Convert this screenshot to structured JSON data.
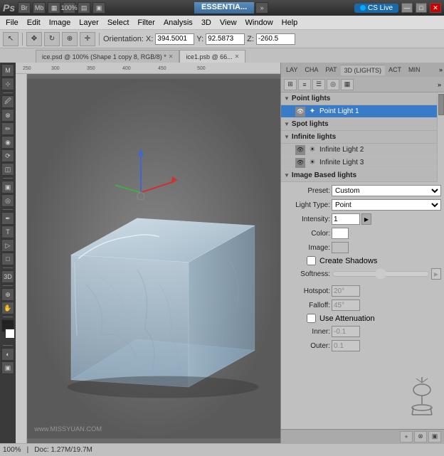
{
  "titlebar": {
    "logo": "Ps",
    "workspace": "ESSENTIA...",
    "cslive": "CS Live",
    "minimize": "—",
    "maximize": "□",
    "close": "✕"
  },
  "menubar": {
    "items": [
      "File",
      "Edit",
      "Image",
      "Layer",
      "Select",
      "Filter",
      "Analysis",
      "3D",
      "View",
      "Window",
      "Help"
    ]
  },
  "toolbar": {
    "zoom": "100%",
    "orientation_label": "Orientation:",
    "x_label": "X:",
    "x_value": "394.5001",
    "y_label": "Y:",
    "y_value": "92.5873",
    "z_label": "Z:",
    "z_value": "-260.5"
  },
  "tabs": [
    {
      "label": "ice.psd @ 100% (Shape 1 copy 8, RGB/8) *",
      "active": true
    },
    {
      "label": "ice1.psb @ 66...",
      "active": false
    }
  ],
  "panel": {
    "tabs": [
      "LAY",
      "CHA",
      "PAT",
      "3D (LIGHTS)",
      "ACT",
      "MIN"
    ],
    "active_tab": "3D (LIGHTS)",
    "icons": [
      "⊞",
      "≡",
      "☰",
      "⊙",
      "▦"
    ]
  },
  "lights": {
    "groups": [
      {
        "name": "Point lights",
        "items": [
          {
            "name": "Point Light 1",
            "selected": true,
            "visible": true
          }
        ]
      },
      {
        "name": "Spot lights",
        "items": []
      },
      {
        "name": "Infinite lights",
        "items": [
          {
            "name": "Infinite Light 2",
            "visible": true
          },
          {
            "name": "Infinite Light 3",
            "visible": true
          }
        ]
      },
      {
        "name": "Image Based lights",
        "items": []
      }
    ]
  },
  "properties": {
    "preset_label": "Preset:",
    "preset_value": "Custom",
    "light_type_label": "Light Type:",
    "light_type_value": "Point",
    "intensity_label": "Intensity:",
    "intensity_value": "1",
    "color_label": "Color:",
    "image_label": "Image:",
    "create_shadows_label": "Create Shadows",
    "softness_label": "Softness:",
    "hotspot_label": "Hotspot:",
    "hotspot_value": "20°",
    "falloff_label": "Falloff:",
    "falloff_value": "45°",
    "use_attenuation_label": "Use Attenuation",
    "inner_label": "Inner:",
    "inner_value": "-0.1",
    "outer_label": "Outer:",
    "outer_value": "0.1"
  },
  "statusbar": {
    "doc_size": "Doc: 1.27M/19.7M"
  },
  "watermark": "www.MISSYUAN.COM"
}
